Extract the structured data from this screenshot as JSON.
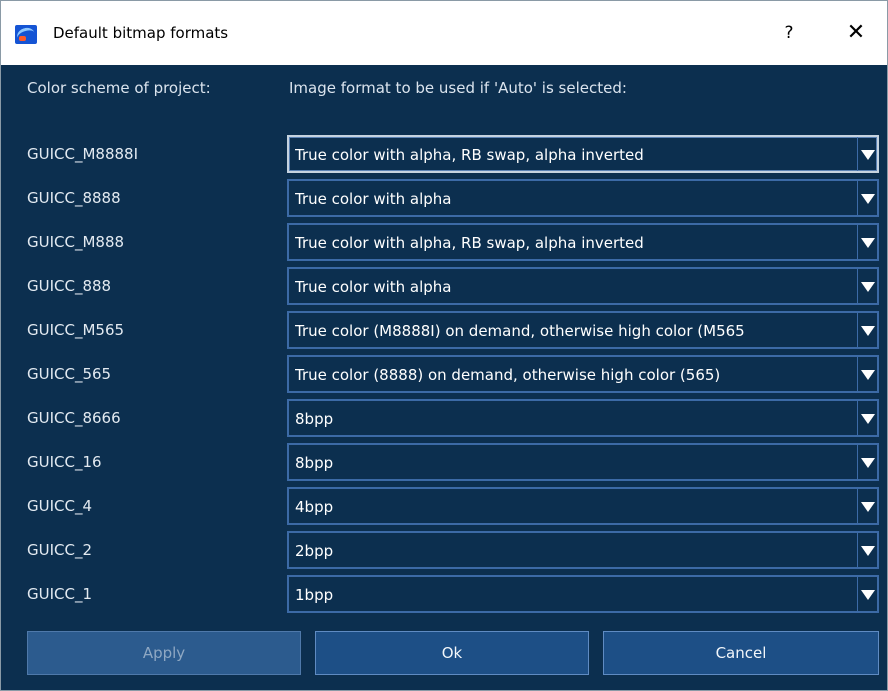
{
  "window": {
    "title": "Default bitmap formats",
    "help_label": "?",
    "close_label": "✕"
  },
  "headers": {
    "color_scheme": "Color scheme of project:",
    "image_format": "Image format to be used if 'Auto' is selected:"
  },
  "rows": [
    {
      "scheme": "GUICC_M8888I",
      "format": "True color with alpha, RB swap, alpha inverted"
    },
    {
      "scheme": "GUICC_8888",
      "format": "True color with alpha"
    },
    {
      "scheme": "GUICC_M888",
      "format": "True color with alpha, RB swap, alpha inverted"
    },
    {
      "scheme": "GUICC_888",
      "format": "True color with alpha"
    },
    {
      "scheme": "GUICC_M565",
      "format": "True color (M8888I) on demand, otherwise high color (M565"
    },
    {
      "scheme": "GUICC_565",
      "format": "True color (8888) on demand, otherwise high color (565)"
    },
    {
      "scheme": "GUICC_8666",
      "format": "8bpp"
    },
    {
      "scheme": "GUICC_16",
      "format": "8bpp"
    },
    {
      "scheme": "GUICC_4",
      "format": "4bpp"
    },
    {
      "scheme": "GUICC_2",
      "format": "2bpp"
    },
    {
      "scheme": "GUICC_1",
      "format": "1bpp"
    }
  ],
  "buttons": {
    "apply": "Apply",
    "ok": "Ok",
    "cancel": "Cancel"
  },
  "icons": {
    "app": "app-logo-icon",
    "dropdown": "dropdown-arrow-icon"
  },
  "colors": {
    "background": "#0c2f4f",
    "combo_border": "#3c6aa6",
    "button_fill": "#1d4f86",
    "text": "#ffffff"
  }
}
